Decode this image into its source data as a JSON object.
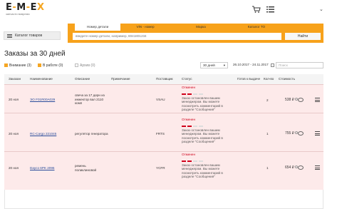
{
  "header": {
    "logo_left": "E",
    "logo_mid": "M",
    "logo_right": "E",
    "logo_x": "X",
    "tagline": "запчасти вовремя"
  },
  "catalog_button": "Каталог товаров",
  "search": {
    "tabs": [
      "Номер детали",
      "VIN - номер",
      "Марка",
      "Каталог ТО"
    ],
    "placeholder": "введите номер детали, например, 8041801234",
    "button": "Найти"
  },
  "page_title": "Заказы за 30 дней",
  "filters": [
    {
      "label": "Внимание",
      "count": "(3)"
    },
    {
      "label": "В работе",
      "count": "(0)"
    },
    {
      "label": "Архив",
      "count": "(0)"
    }
  ],
  "period_select": "30 дней",
  "date_range": "26.10.2017 - 24.11.2017",
  "search_orders_placeholder": "Поиск",
  "table": {
    "columns": [
      "Заказан",
      "Наименование",
      "Описание",
      "Примечание",
      "Поставщик",
      "Статус",
      "Готов к выдаче",
      "Кол-во",
      "Стоимость"
    ],
    "rows": [
      {
        "date": "20 ноя",
        "name": "ЭО F01R00A029",
        "description": "свеча за 17 дерн из инжектор вал 2110 комп",
        "supplier": "VSAU",
        "status_label": "Отменен",
        "status_text": "Заказ остановлен вашим менеджером. Вы можете посмотреть комментарий в разделе \"Сообщения\"",
        "qty": "2",
        "price": "538 ₽"
      },
      {
        "date": "20 ноя",
        "name": "RC-Cargo 221045",
        "description": "регулятор генератора",
        "supplier": "FRTS",
        "status_label": "Отменен",
        "status_text": "Заказ остановлен вашим менеджером. Вы можете посмотреть комментарий в разделе \"Сообщения\"",
        "qty": "1",
        "price": "755 ₽"
      },
      {
        "date": "20 ноя",
        "name": "Dayco 6PK 2095",
        "description": "ремень поликлиновой",
        "supplier": "YCFR",
        "status_label": "Отменен",
        "status_text": "Заказ остановлен вашим менеджером. Вы можете посмотреть комментарий в разделе \"Сообщения\"",
        "qty": "1",
        "price": "654 ₽"
      }
    ]
  }
}
